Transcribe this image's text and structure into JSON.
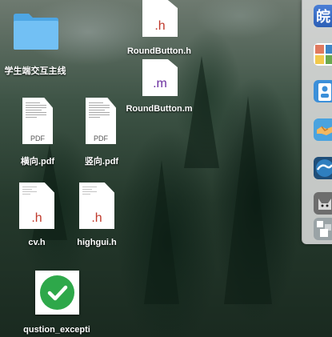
{
  "desktop": {
    "items": [
      {
        "label": "学生端交互主线",
        "kind": "folder"
      },
      {
        "label": "RoundButton.h",
        "kind": "header-file",
        "ext": ".h"
      },
      {
        "label": "RoundButton.m",
        "kind": "objc-file",
        "ext": ".m"
      },
      {
        "label": "横向.pdf",
        "kind": "pdf",
        "ext": "PDF"
      },
      {
        "label": "竖向.pdf",
        "kind": "pdf",
        "ext": "PDF"
      },
      {
        "label": "cv.h",
        "kind": "header-file",
        "ext": ".h"
      },
      {
        "label": "highgui.h",
        "kind": "header-file",
        "ext": ".h"
      },
      {
        "label": "qustion_excepti",
        "kind": "image",
        "icon": "checkmark-icon"
      }
    ]
  },
  "dock": {
    "items": [
      {
        "icon": "app-icon-chinese-text",
        "glyph": "皖"
      },
      {
        "icon": "app-icon-photo-grid"
      },
      {
        "icon": "contacts-badge-icon"
      },
      {
        "icon": "handshake-icon"
      },
      {
        "icon": "wave-app-icon"
      },
      {
        "icon": "cat-app-icon"
      },
      {
        "icon": "pixel-app-icon"
      }
    ]
  },
  "colors": {
    "header_ext": "#c0392b",
    "objc_ext": "#6b2fa0",
    "folder": "#5ab4ee",
    "check": "#2ea84a"
  }
}
